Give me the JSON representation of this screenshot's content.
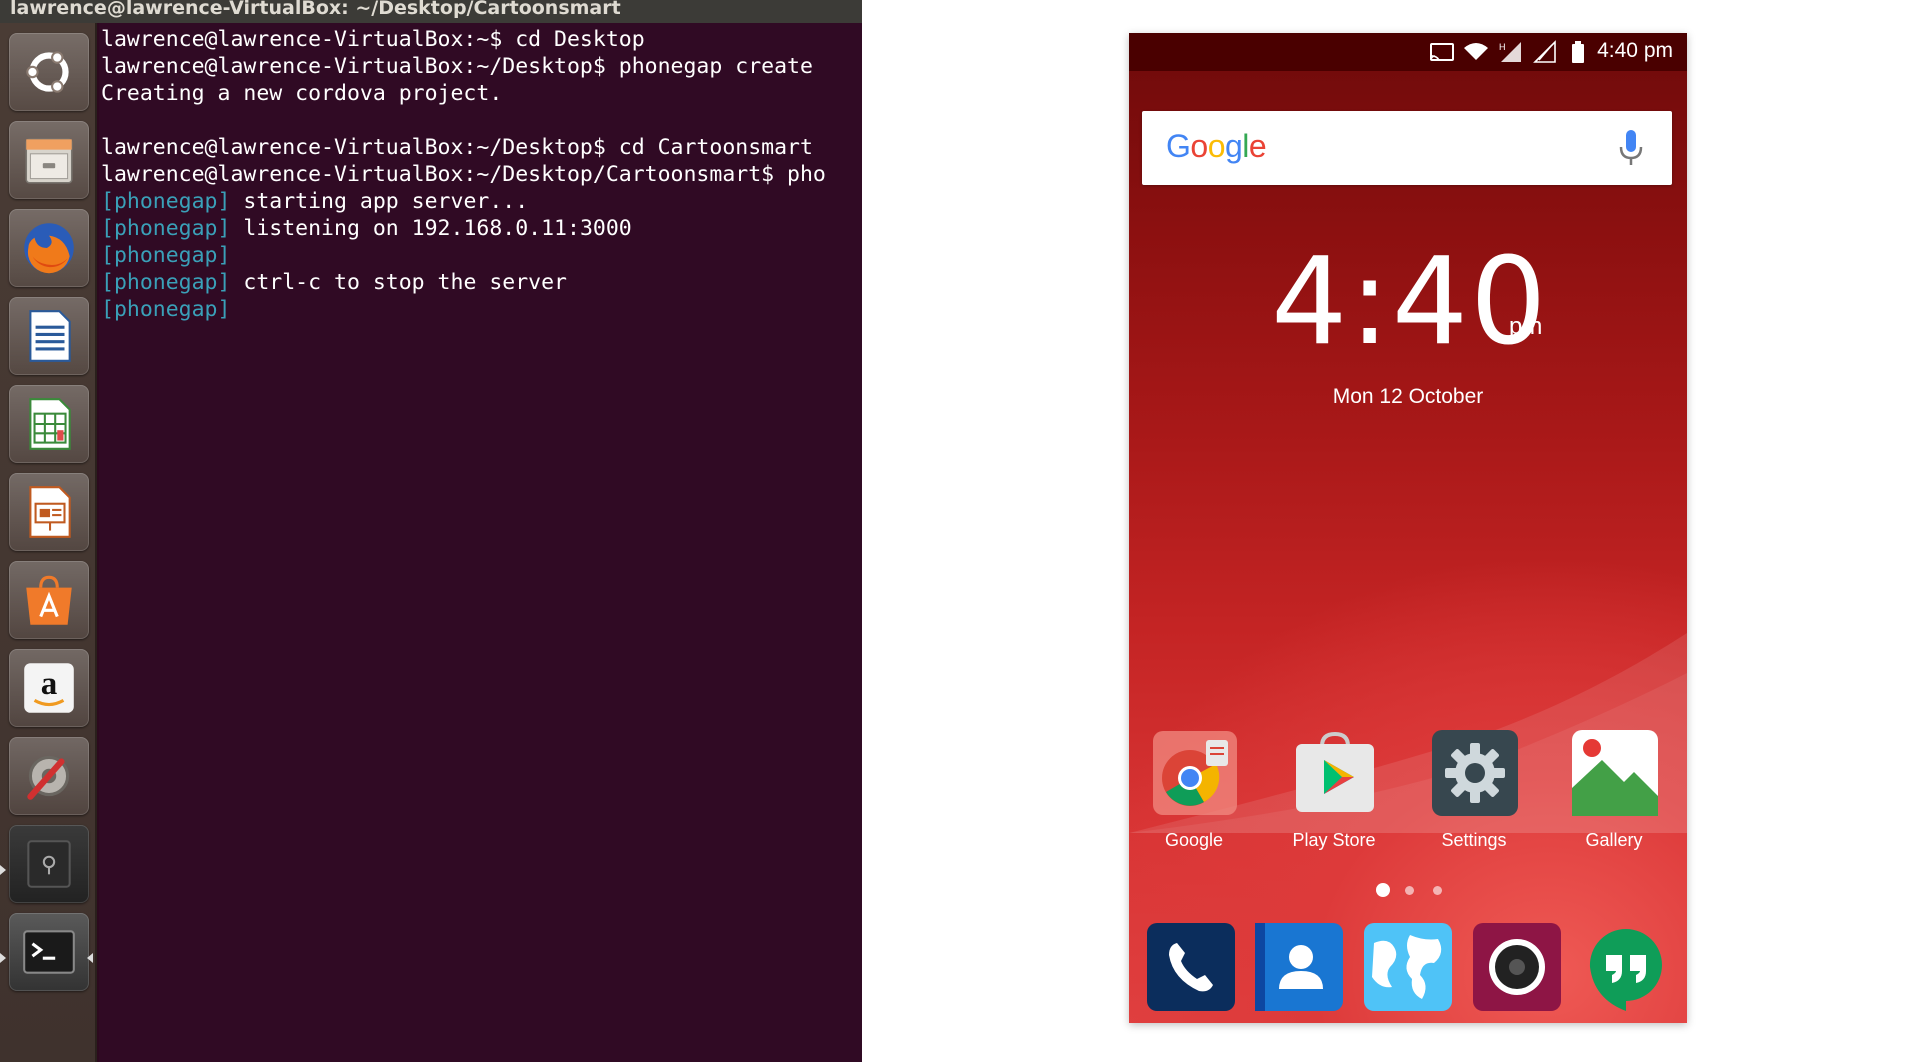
{
  "window": {
    "title": "lawrence@lawrence-VirtualBox: ~/Desktop/Cartoonsmart"
  },
  "launcher": {
    "items": [
      {
        "name": "ubuntu-dash-icon"
      },
      {
        "name": "files-icon"
      },
      {
        "name": "firefox-icon"
      },
      {
        "name": "libreoffice-writer-icon"
      },
      {
        "name": "libreoffice-calc-icon"
      },
      {
        "name": "libreoffice-impress-icon"
      },
      {
        "name": "software-center-icon"
      },
      {
        "name": "amazon-icon"
      },
      {
        "name": "system-settings-icon"
      },
      {
        "name": "disk-icon"
      },
      {
        "name": "terminal-icon"
      }
    ]
  },
  "terminal": {
    "lines": [
      {
        "tag": "",
        "text": "lawrence@lawrence-VirtualBox:~$ cd Desktop"
      },
      {
        "tag": "",
        "text": "lawrence@lawrence-VirtualBox:~/Desktop$ phonegap create"
      },
      {
        "tag": "",
        "text": "Creating a new cordova project."
      },
      {
        "tag": "",
        "text": ""
      },
      {
        "tag": "",
        "text": "lawrence@lawrence-VirtualBox:~/Desktop$ cd Cartoonsmart"
      },
      {
        "tag": "",
        "text": "lawrence@lawrence-VirtualBox:~/Desktop/Cartoonsmart$ pho"
      },
      {
        "tag": "[phonegap]",
        "text": " starting app server..."
      },
      {
        "tag": "[phonegap]",
        "text": " listening on 192.168.0.11:3000"
      },
      {
        "tag": "[phonegap]",
        "text": ""
      },
      {
        "tag": "[phonegap]",
        "text": " ctrl-c to stop the server"
      },
      {
        "tag": "[phonegap]",
        "text": ""
      }
    ]
  },
  "phone": {
    "status": {
      "time": "4:40 pm"
    },
    "search": {
      "logo": [
        "G",
        "o",
        "o",
        "g",
        "l",
        "e"
      ],
      "logo_colors": [
        "#4285F4",
        "#EA4335",
        "#FBBC05",
        "#4285F4",
        "#34A853",
        "#EA4335"
      ]
    },
    "clock": {
      "time": "4:40",
      "ampm": "pm",
      "date": "Mon 12 October"
    },
    "apps": [
      {
        "label": "Google",
        "icon": "chrome-icon"
      },
      {
        "label": "Play Store",
        "icon": "play-store-icon"
      },
      {
        "label": "Settings",
        "icon": "settings-gear-icon"
      },
      {
        "label": "Gallery",
        "icon": "gallery-icon"
      }
    ],
    "dock": [
      {
        "icon": "phone-icon"
      },
      {
        "icon": "contacts-icon"
      },
      {
        "icon": "browser-globe-icon"
      },
      {
        "icon": "camera-icon"
      },
      {
        "icon": "hangouts-icon"
      }
    ],
    "colors": {
      "accent_red": "#c42424",
      "status_bar": "#4a0000"
    }
  }
}
